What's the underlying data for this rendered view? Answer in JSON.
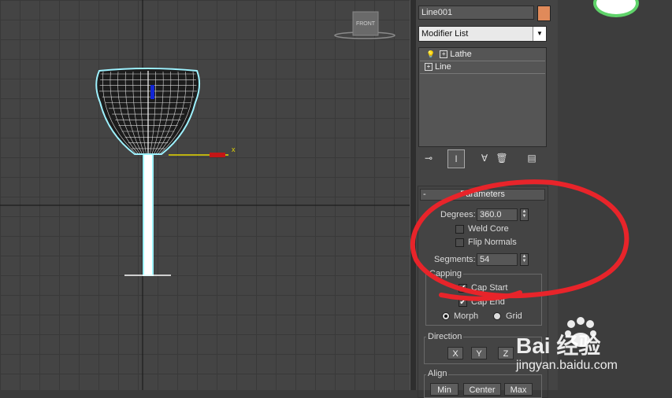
{
  "viewport": {
    "nav_cube_label": "FRONT",
    "axis_x_label": "x"
  },
  "command_panel": {
    "object_name": "Line001",
    "object_color": "#e08a5a",
    "modifier_list": "Modifier List",
    "stack": [
      {
        "label": "Lathe",
        "icon": "lightbulb-icon"
      },
      {
        "label": "Line"
      }
    ]
  },
  "parameters": {
    "title": "Parameters",
    "collapse_symbol": "-",
    "degrees_label": "Degrees:",
    "degrees_value": "360.0",
    "weld_core_label": "Weld Core",
    "weld_core_checked": false,
    "flip_normals_label": "Flip Normals",
    "flip_normals_checked": false,
    "segments_label": "Segments:",
    "segments_value": "54",
    "capping": {
      "title": "Capping",
      "cap_start_label": "Cap Start",
      "cap_start_checked": true,
      "cap_end_label": "Cap End",
      "cap_end_checked": true,
      "morph_label": "Morph",
      "grid_label": "Grid",
      "selected": "Morph"
    },
    "direction": {
      "title": "Direction",
      "buttons": [
        "X",
        "Y",
        "Z"
      ]
    },
    "align": {
      "title": "Align",
      "buttons": [
        "Min",
        "Center",
        "Max"
      ]
    }
  },
  "annotation_color": "#e8242a",
  "watermark": {
    "brand": "Bai 经验",
    "url": "jingyan.baidu.com"
  }
}
